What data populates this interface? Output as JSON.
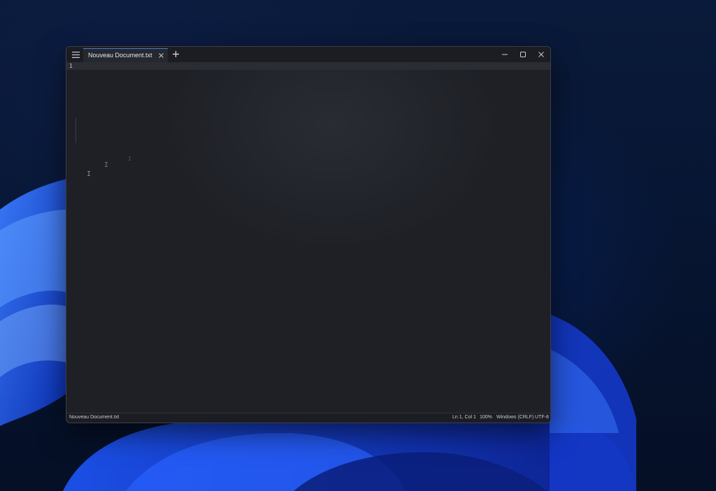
{
  "window": {
    "tab_title": "Nouveau Document.txt"
  },
  "editor": {
    "line_numbers": [
      "1"
    ],
    "cursor_glyph": "I"
  },
  "statusbar": {
    "file_name": "Nouveau Document.txt",
    "position": "Ln 1, Col 1",
    "zoom": "100%",
    "line_ending": "Windows (CRLF)",
    "encoding": "UTF-8"
  },
  "icons": {
    "menu": "hamburger-icon",
    "tab_close": "close-icon",
    "new_tab": "plus-icon",
    "minimize": "minimize-icon",
    "maximize": "maximize-icon",
    "close": "close-icon"
  },
  "colors": {
    "accent": "#4a78c9",
    "window_bg": "#1f2127",
    "desktop_bloom": "#1f4fe0"
  }
}
